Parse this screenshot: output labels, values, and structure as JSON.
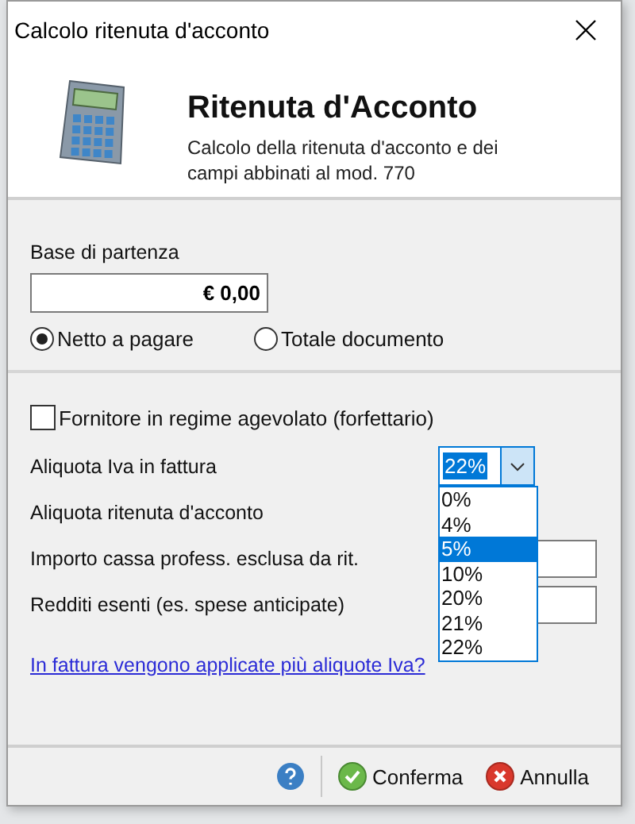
{
  "window": {
    "title": "Calcolo ritenuta d'acconto"
  },
  "header": {
    "title": "Ritenuta d'Acconto",
    "subtitle": "Calcolo della ritenuta d'acconto e dei campi abbinati al mod. 770"
  },
  "base": {
    "label": "Base di partenza",
    "value": "€ 0,00"
  },
  "base_type": [
    {
      "label": "Netto a pagare",
      "selected": true
    },
    {
      "label": "Totale documento",
      "selected": false
    }
  ],
  "forfettario": {
    "label": "Fornitore in regime agevolato (forfettario)",
    "checked": false
  },
  "iva": {
    "label": "Aliquota Iva in fattura",
    "value": "22%",
    "expanded": true,
    "options": [
      {
        "label": "0%",
        "highlighted": false
      },
      {
        "label": "4%",
        "highlighted": false
      },
      {
        "label": "5%",
        "highlighted": true
      },
      {
        "label": "10%",
        "highlighted": false
      },
      {
        "label": "20%",
        "highlighted": false
      },
      {
        "label": "21%",
        "highlighted": false
      },
      {
        "label": "22%",
        "highlighted": false
      }
    ]
  },
  "fields": [
    {
      "label": "Aliquota ritenuta d'acconto",
      "kind": "plain"
    },
    {
      "label": "Importo cassa profess. esclusa da rit.",
      "kind": "input"
    },
    {
      "label": "Redditi esenti (es. spese anticipate)",
      "kind": "input"
    }
  ],
  "link": "In fattura vengono applicate più aliquote Iva?",
  "buttons": [
    {
      "kind": "help"
    },
    {
      "kind": "confirm",
      "label": "Conferma"
    },
    {
      "kind": "cancel",
      "label": "Annulla"
    }
  ]
}
